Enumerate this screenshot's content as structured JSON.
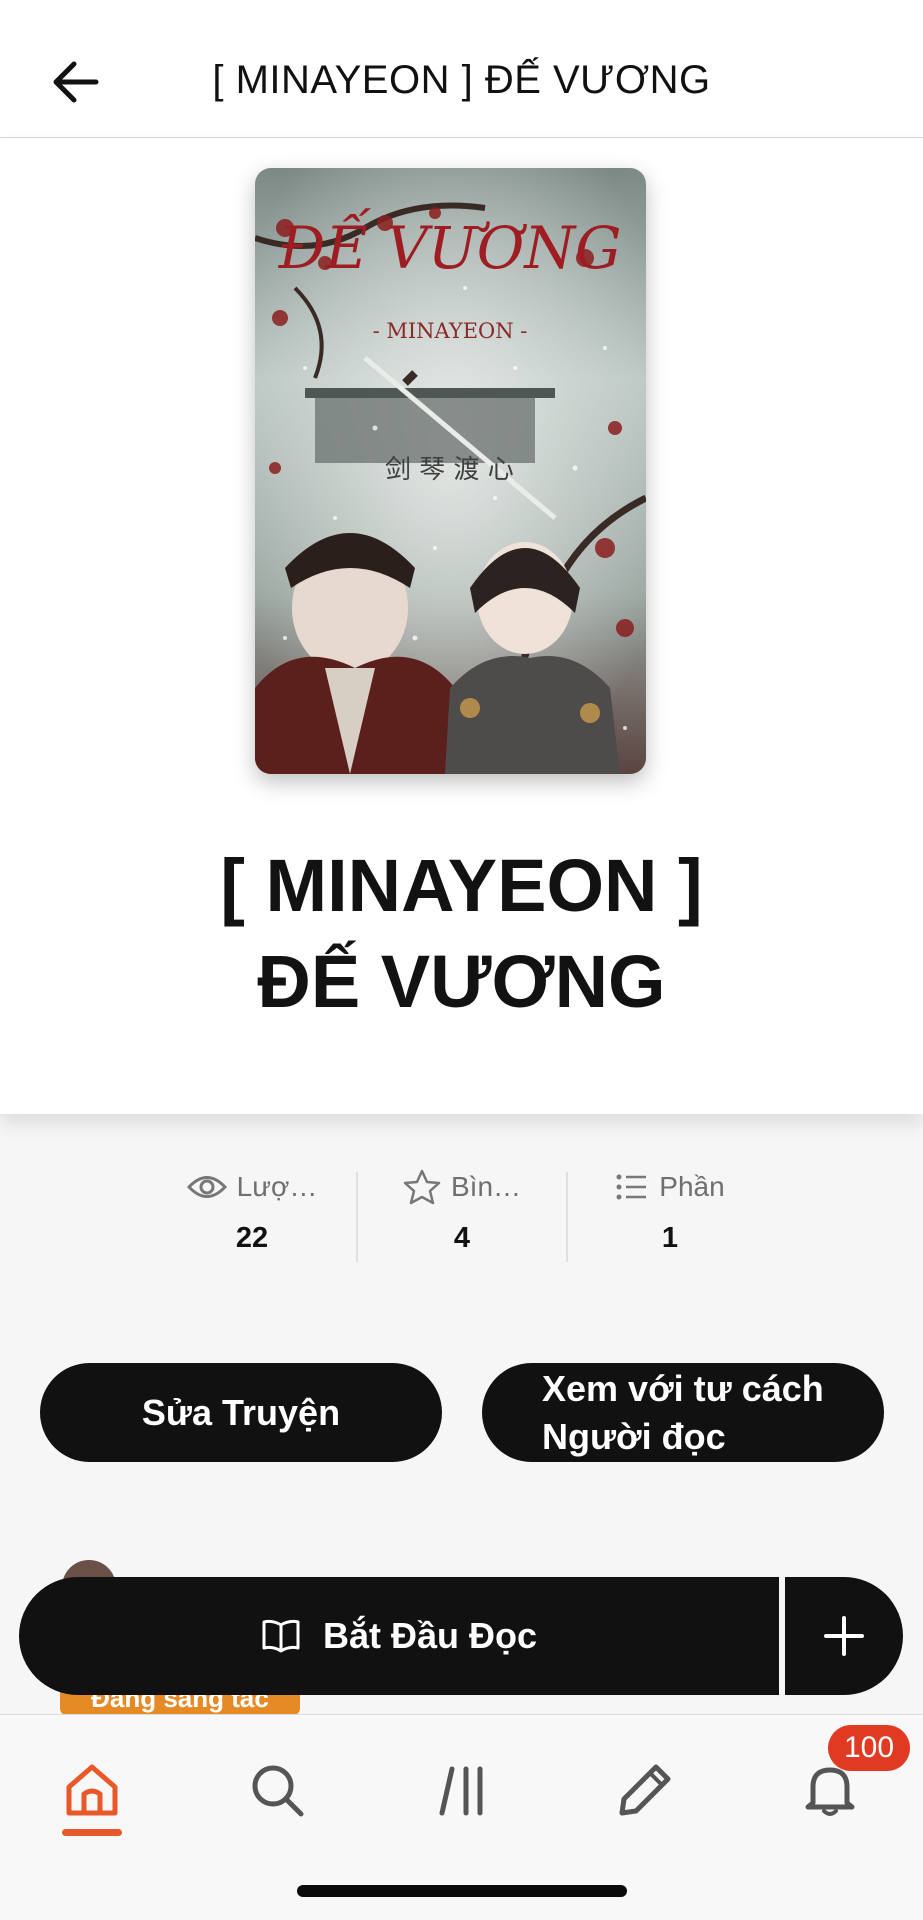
{
  "header": {
    "title": "[ MINAYEON ] ĐẾ VƯƠNG"
  },
  "cover": {
    "title_art": "ĐẾ VƯƠNG",
    "author_art": "- MINAYEON -",
    "calligraphy": "剑 琴 渡 心"
  },
  "story": {
    "title_line1": "[ MINAYEON ]",
    "title_line2": "ĐẾ VƯƠNG"
  },
  "stats": [
    {
      "icon": "eye-icon",
      "label": "Lượ…",
      "value": "22"
    },
    {
      "icon": "star-icon",
      "label": "Bìn…",
      "value": "4"
    },
    {
      "icon": "list-icon",
      "label": "Phần",
      "value": "1"
    }
  ],
  "actions": {
    "edit_label": "Sửa Truyện",
    "reader_line1": "Xem với tư cách",
    "reader_line2": "Người đọc"
  },
  "status_badge": "Đang sáng tác",
  "read_button": {
    "label": "Bắt Đầu Đọc"
  },
  "tabbar": {
    "notifications_count": "100",
    "active": "home",
    "accent_color": "#e8592a"
  }
}
